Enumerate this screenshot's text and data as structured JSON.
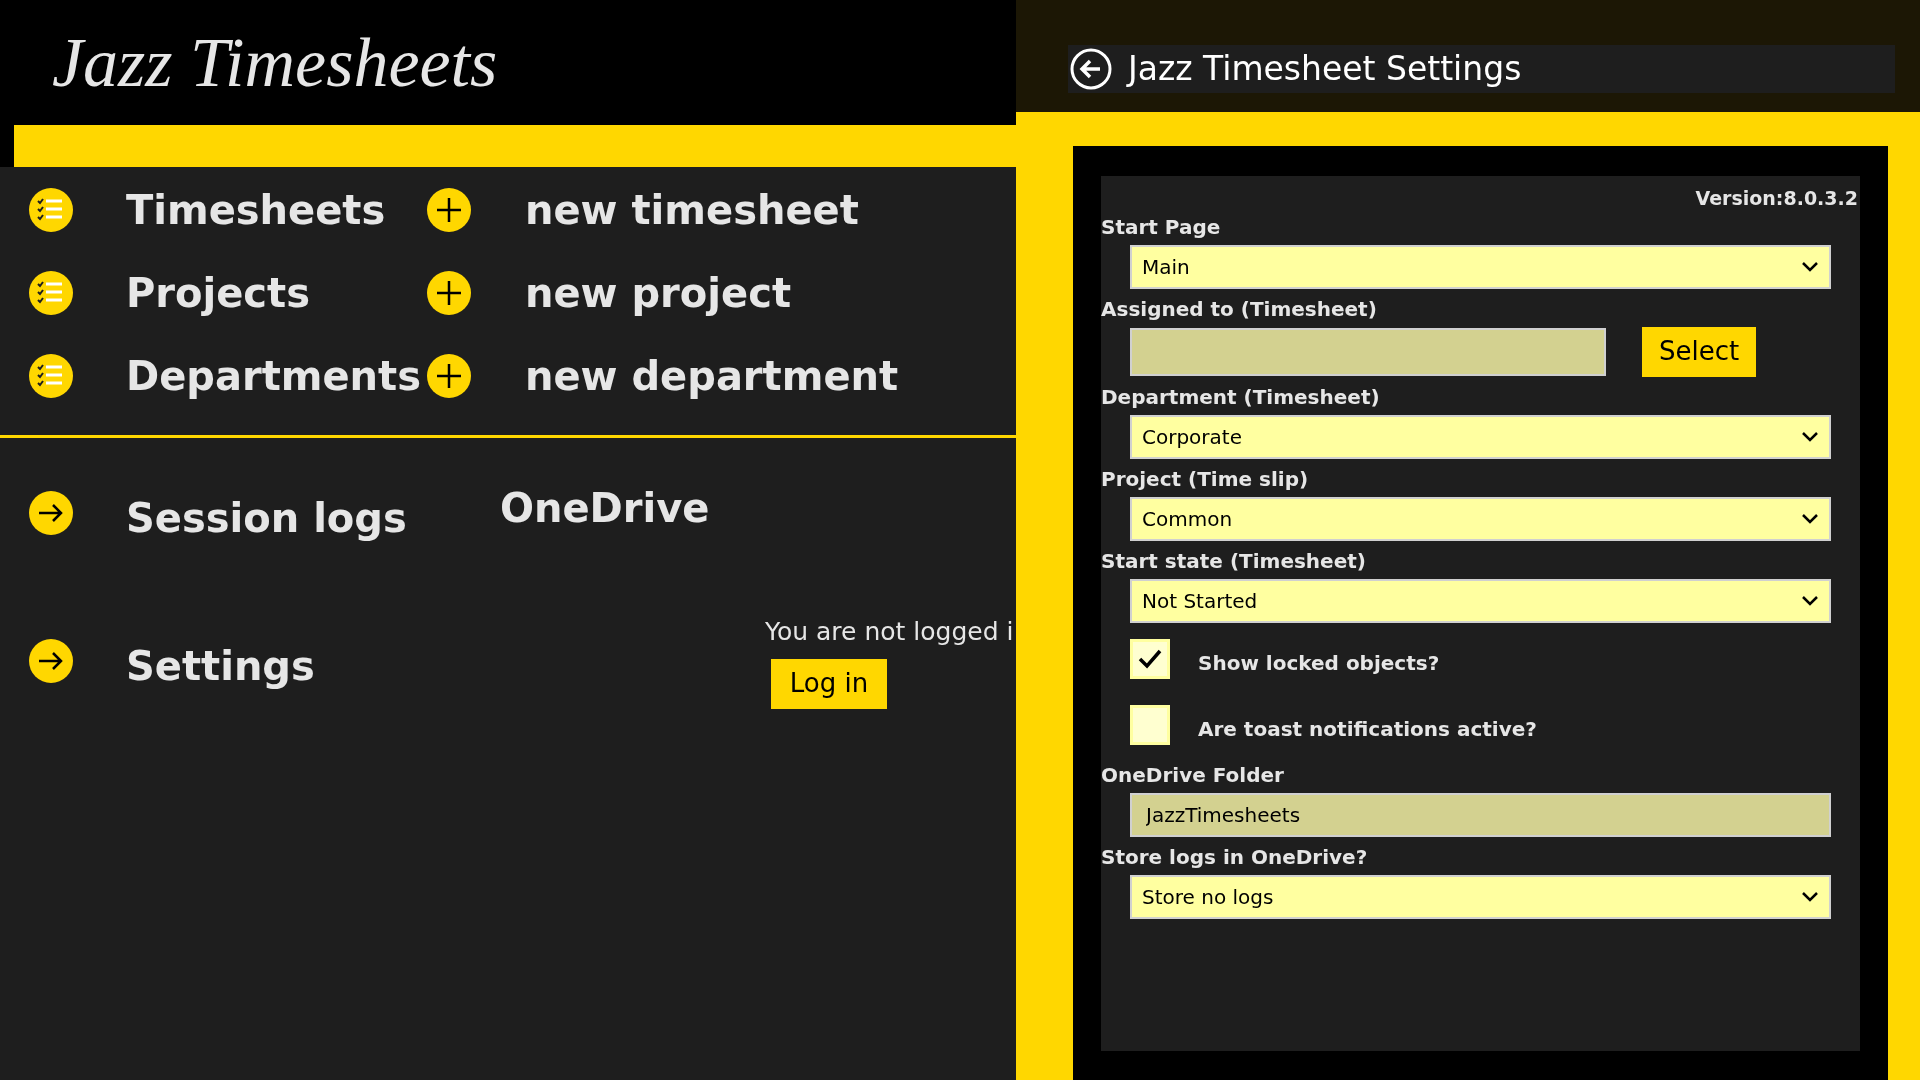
{
  "app_title": "Jazz Timesheets",
  "nav": [
    {
      "label": "Timesheets",
      "action": "new timesheet"
    },
    {
      "label": "Projects",
      "action": "new project"
    },
    {
      "label": "Departments",
      "action": "new department"
    }
  ],
  "links": [
    {
      "label": "Session logs"
    },
    {
      "label": "Settings"
    }
  ],
  "onedrive": {
    "title": "OneDrive",
    "message": "You are not logged i",
    "button": "Log in"
  },
  "settings": {
    "title": "Jazz Timesheet Settings",
    "version": "Version:8.0.3.2",
    "fields": [
      {
        "kind": "dropdown",
        "label": "Start Page",
        "value": "Main"
      },
      {
        "kind": "text",
        "label": "Assigned to (Timesheet)",
        "button": "Select"
      },
      {
        "kind": "dropdown",
        "label": "Department (Timesheet)",
        "value": "Corporate"
      },
      {
        "kind": "dropdown",
        "label": "Project (Time slip)",
        "value": "Common"
      },
      {
        "kind": "dropdown",
        "label": "Start state (Timesheet)",
        "value": "Not Started"
      },
      {
        "kind": "checkbox",
        "label": "Show locked objects?",
        "checked": true
      },
      {
        "kind": "checkbox",
        "label": "Are toast notifications active?",
        "checked": false
      },
      {
        "kind": "text",
        "label": "OneDrive Folder",
        "value": "JazzTimesheets"
      },
      {
        "kind": "dropdown",
        "label": "Store logs in OneDrive?",
        "value": "Store no logs"
      }
    ]
  }
}
